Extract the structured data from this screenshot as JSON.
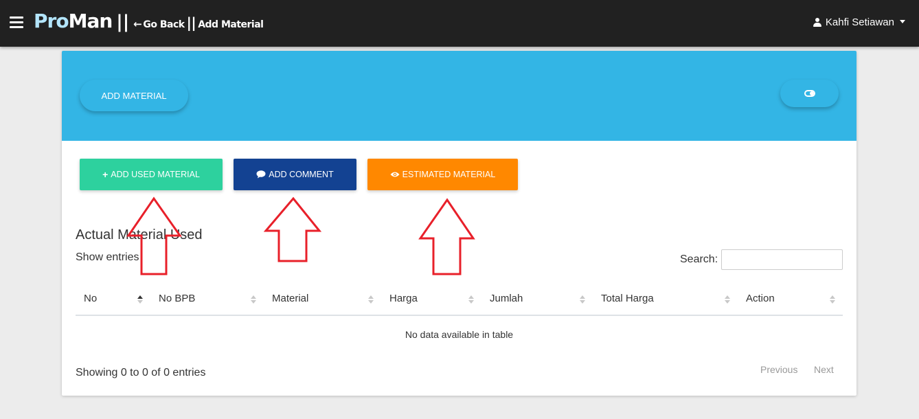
{
  "navbar": {
    "brand_pro": "Pro",
    "brand_man": "Man",
    "separator": "||",
    "go_back": "Go Back",
    "separator2": "||",
    "page_name": "Add Material",
    "user_name": "Kahfi Setiawan"
  },
  "header": {
    "add_material_label": "ADD MATERIAL"
  },
  "actions": {
    "add_used_material": "ADD USED MATERIAL",
    "add_comment": "ADD COMMENT",
    "estimated_material": "ESTIMATED MATERIAL"
  },
  "colors": {
    "navbar_bg": "#212121",
    "header_bg": "#33b5e5",
    "add_used_material_bg": "#2dd19e",
    "add_comment_bg": "#134292",
    "estimated_material_bg": "#ff8800",
    "annotation_arrow": "#e8202a"
  },
  "icons": {
    "menu": "hamburger-icon",
    "back": "arrow-left-icon",
    "user": "user-icon",
    "toggle": "toggle-icon",
    "plus": "plus-icon",
    "comment": "comment-icon",
    "eye": "eye-icon"
  },
  "table_section": {
    "title": "Actual Material Used",
    "show_entries": "Show entries",
    "search_label": "Search:",
    "search_value": "",
    "columns": [
      "No",
      "No BPB",
      "Material",
      "Harga",
      "Jumlah",
      "Total Harga",
      "Action"
    ],
    "sorted_column": "No",
    "empty_message": "No data available in table",
    "showing_text": "Showing 0 to 0 of 0 entries",
    "previous_label": "Previous",
    "next_label": "Next"
  }
}
